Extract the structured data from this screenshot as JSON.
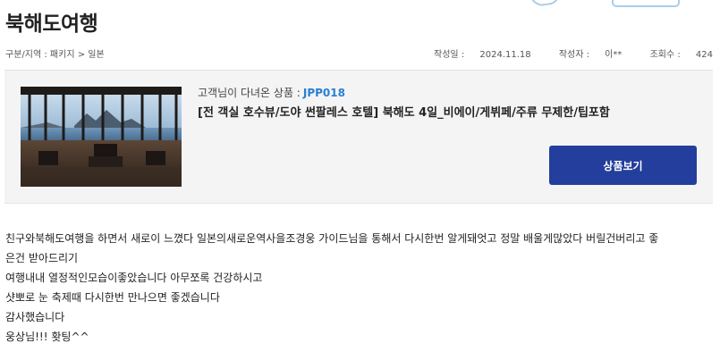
{
  "post": {
    "title": "북해도여행",
    "category_label": "구분/지역",
    "category_path": "패키지 > 일본",
    "date_label": "작성일",
    "date": "2024.11.18",
    "author_label": "작성자",
    "author": "이**",
    "views_label": "조회수",
    "views": "424"
  },
  "product": {
    "visited_label": "고객님이 다녀온 상품 :",
    "code": "JPP018",
    "name": "[전 객실 호수뷰/도야 썬팔레스 호텔] 북해도 4일_비에이/게뷔페/주류 무제한/팁포함",
    "button_label": "상품보기",
    "image_icon": "hotel-lake-view-photo"
  },
  "review": {
    "lines": [
      "친구와북해도여행을 하면서 새로이  느꼈다  일본의새로운역사을조경웅 가이드님을 통해서  다시한번 알게돼엇고 정말 배울게많았다 버릴건버리고 좋",
      "은건  받아드리기",
      "여행내내 열정적인모습이좋았습니다   아무쪼록 건강하시고",
      "샷뽀로 눈 축제때 다시한번 만나으면 좋겠습니다",
      "감사했습니다",
      "웅상님!!! 홧팅^^"
    ]
  },
  "colors": {
    "accent_blue": "#233e9c",
    "code_blue": "#2a7fd4",
    "box_bg": "#f4f4f4"
  }
}
